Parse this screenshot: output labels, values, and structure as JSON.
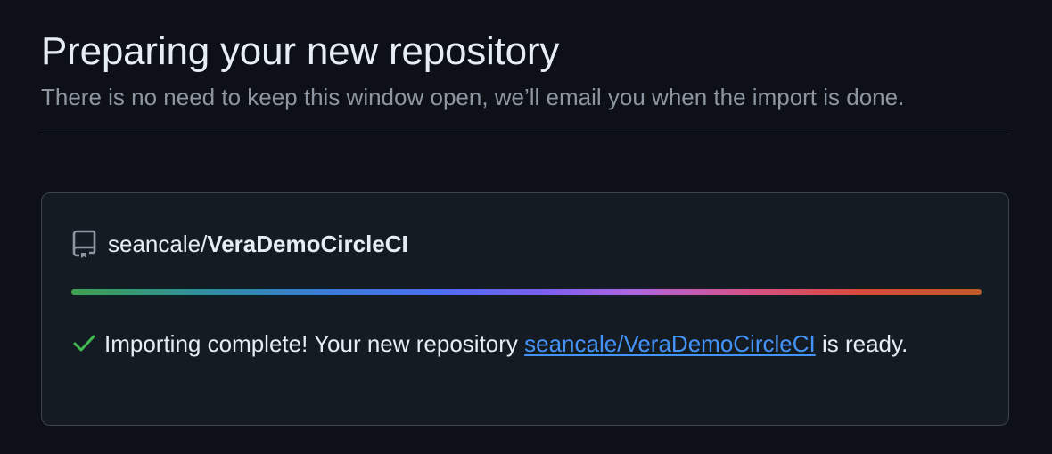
{
  "page": {
    "title": "Preparing your new repository",
    "subtitle": "There is no need to keep this window open, we’ll email you when the import is done."
  },
  "repo": {
    "owner": "seancale/",
    "name": "VeraDemoCircleCI",
    "icon": "repo-icon"
  },
  "import_status": {
    "progress_percent": 100,
    "icon": "check-icon",
    "message_prefix": "Importing complete! Your new repository ",
    "link_text": "seancale/VeraDemoCircleCI",
    "message_suffix": " is ready."
  },
  "colors": {
    "background": "#0d1117",
    "card_background": "#151b23",
    "link": "#4493f8",
    "success": "#3fb950"
  }
}
